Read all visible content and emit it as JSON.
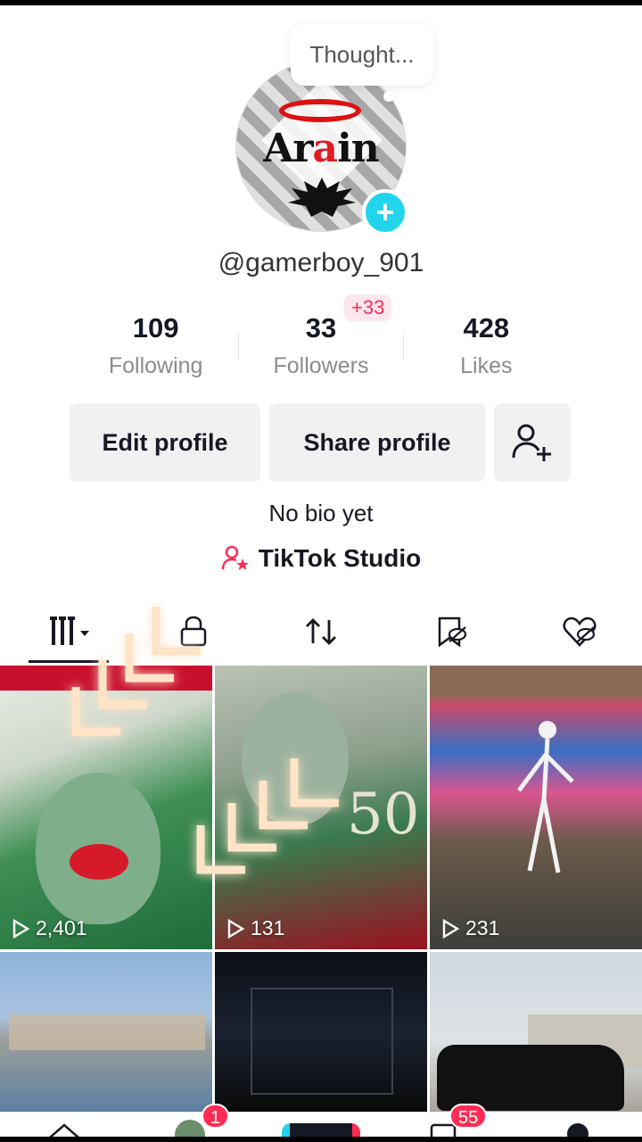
{
  "profile": {
    "thought_placeholder": "Thought...",
    "avatar_text_left": "Ar",
    "avatar_text_red": "a",
    "avatar_text_right": "in",
    "username": "@gamerboy_901",
    "stats": {
      "following_count": "109",
      "following_label": "Following",
      "followers_count": "33",
      "followers_label": "Followers",
      "followers_new": "+33",
      "likes_count": "428",
      "likes_label": "Likes"
    },
    "buttons": {
      "edit": "Edit profile",
      "share": "Share profile",
      "add_friends_icon": "add-user-icon"
    },
    "bio": "No bio yet",
    "studio_label": "TikTok Studio"
  },
  "tabs": [
    {
      "icon": "grid-icon",
      "active": true
    },
    {
      "icon": "lock-icon"
    },
    {
      "icon": "repost-icon"
    },
    {
      "icon": "favorites-hidden-icon"
    },
    {
      "icon": "liked-hidden-icon"
    }
  ],
  "videos": [
    {
      "views": "2,401",
      "theme": "currency-note-face"
    },
    {
      "views": "131",
      "theme": "currency-note-50"
    },
    {
      "views": "231",
      "theme": "skeleton-carpet"
    },
    {
      "theme": "street-scene"
    },
    {
      "theme": "dark-outline"
    },
    {
      "theme": "black-suv"
    }
  ],
  "bottom_nav": {
    "friends_badge": "1",
    "inbox_badge": "55"
  },
  "colors": {
    "accent": "#fe2c55",
    "cyan": "#20d5ec",
    "text": "#161823",
    "muted": "#8a8b91",
    "button_bg": "#f1f1f2"
  }
}
